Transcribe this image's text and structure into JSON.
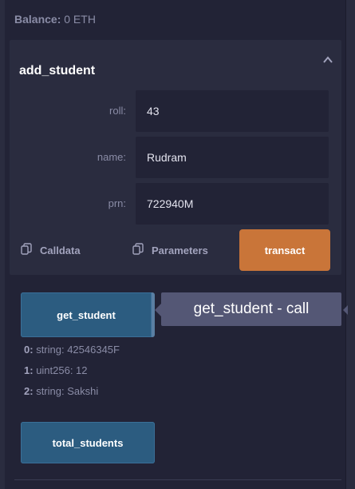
{
  "balance": {
    "label": "Balance:",
    "value": "0 ETH"
  },
  "function": {
    "name": "add_student",
    "fields": [
      {
        "label": "roll:",
        "value": "43"
      },
      {
        "label": "name:",
        "value": "Rudram"
      },
      {
        "label": "prn:",
        "value": "722940M"
      }
    ],
    "calldata_label": "Calldata",
    "parameters_label": "Parameters",
    "transact_label": "transact"
  },
  "get_student": {
    "button_label": "get_student",
    "tooltip": "get_student - call",
    "results": [
      {
        "idx": "0:",
        "text": "string: 42546345F"
      },
      {
        "idx": "1:",
        "text": "uint256: 12"
      },
      {
        "idx": "2:",
        "text": "string: Sakshi"
      }
    ]
  },
  "total_students": {
    "button_label": "total_students"
  },
  "colors": {
    "background": "#222336",
    "card": "#2a2c3f",
    "accent_transact": "#c97539",
    "call_button": "#2c5c80",
    "tooltip": "#545775"
  },
  "icons": {
    "collapse": "chevron-up-icon",
    "copy": "copy-icon"
  }
}
